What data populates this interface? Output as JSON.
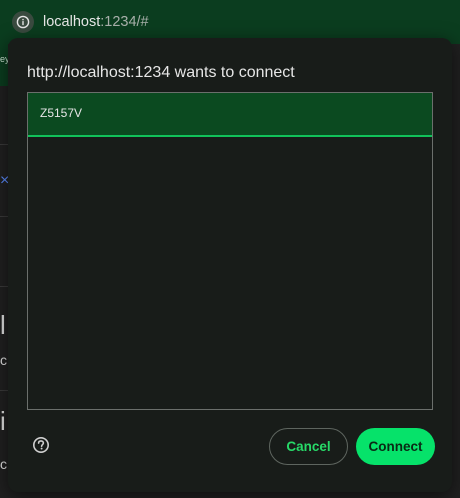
{
  "browser": {
    "url_host": "localhost",
    "url_rest": ":1234/#",
    "info_icon": "info-icon"
  },
  "background_page": {
    "fragments": [
      "ey",
      "×",
      "l",
      "c",
      "i",
      "c"
    ]
  },
  "dialog": {
    "title": "http://localhost:1234 wants to connect",
    "devices": [
      {
        "name": "Z5157V",
        "selected": true
      }
    ],
    "help_icon": "help-circle-icon",
    "cancel_label": "Cancel",
    "connect_label": "Connect"
  },
  "colors": {
    "accent": "#06e26a",
    "selected_row": "#0b4a20",
    "dialog_background": "#181c19",
    "address_bar": "#0b3d1f"
  }
}
